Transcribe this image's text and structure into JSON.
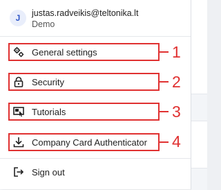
{
  "user": {
    "initial": "J",
    "email": "justas.radveikis@teltonika.lt",
    "company": "Demo"
  },
  "menu": {
    "items": [
      {
        "label": "General settings",
        "icon": "gears-icon",
        "callout": "1"
      },
      {
        "label": "Security",
        "icon": "lock-icon",
        "callout": "2"
      },
      {
        "label": "Tutorials",
        "icon": "tutorial-screen-icon",
        "callout": "3"
      },
      {
        "label": "Company Card Authenticator",
        "icon": "download-icon",
        "callout": "4"
      }
    ],
    "signout": {
      "label": "Sign out",
      "icon": "sign-out-icon"
    }
  },
  "colors": {
    "highlight": "#e03131",
    "avatar_text": "#2f56c8",
    "avatar_bg": "#e9eefb"
  }
}
